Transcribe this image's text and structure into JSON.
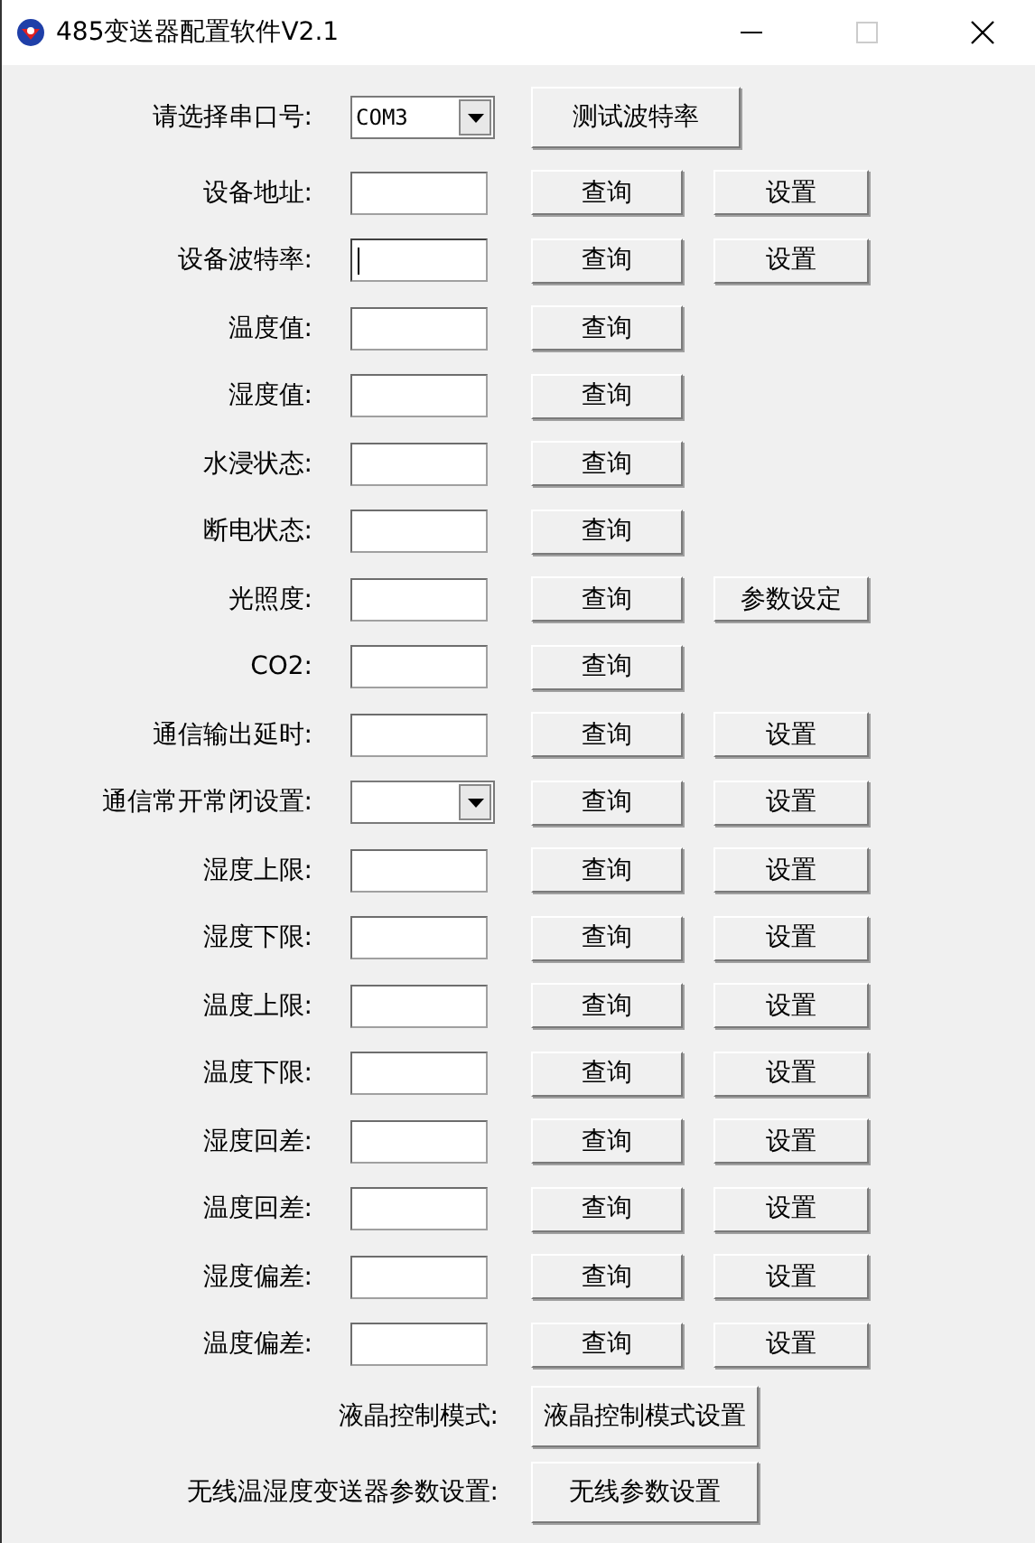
{
  "window": {
    "title": "485变送器配置软件V2.1"
  },
  "rows": [
    {
      "kind": "combo",
      "label": "请选择串口号:",
      "value": "COM3",
      "buttons": [
        "测试波特率"
      ]
    },
    {
      "kind": "field",
      "label": "设备地址:",
      "focused": false,
      "buttons": [
        "查询",
        "设置"
      ]
    },
    {
      "kind": "field",
      "label": "设备波特率:",
      "focused": true,
      "buttons": [
        "查询",
        "设置"
      ]
    },
    {
      "kind": "field",
      "label": "温度值:",
      "focused": false,
      "buttons": [
        "查询"
      ]
    },
    {
      "kind": "field",
      "label": "湿度值:",
      "focused": false,
      "buttons": [
        "查询"
      ]
    },
    {
      "kind": "field",
      "label": "水浸状态:",
      "focused": false,
      "buttons": [
        "查询"
      ]
    },
    {
      "kind": "field",
      "label": "断电状态:",
      "focused": false,
      "buttons": [
        "查询"
      ]
    },
    {
      "kind": "field",
      "label": "光照度:",
      "focused": false,
      "buttons": [
        "查询",
        "参数设定"
      ]
    },
    {
      "kind": "field",
      "label": "CO2:",
      "focused": false,
      "buttons": [
        "查询"
      ]
    },
    {
      "kind": "field",
      "label": "通信输出延时:",
      "focused": false,
      "buttons": [
        "查询",
        "设置"
      ]
    },
    {
      "kind": "dropdown",
      "label": "通信常开常闭设置:",
      "buttons": [
        "查询",
        "设置"
      ]
    },
    {
      "kind": "field",
      "label": "湿度上限:",
      "focused": false,
      "buttons": [
        "查询",
        "设置"
      ]
    },
    {
      "kind": "field",
      "label": "湿度下限:",
      "focused": false,
      "buttons": [
        "查询",
        "设置"
      ]
    },
    {
      "kind": "field",
      "label": "温度上限:",
      "focused": false,
      "buttons": [
        "查询",
        "设置"
      ]
    },
    {
      "kind": "field",
      "label": "温度下限:",
      "focused": false,
      "buttons": [
        "查询",
        "设置"
      ]
    },
    {
      "kind": "field",
      "label": "湿度回差:",
      "focused": false,
      "buttons": [
        "查询",
        "设置"
      ]
    },
    {
      "kind": "field",
      "label": "温度回差:",
      "focused": false,
      "buttons": [
        "查询",
        "设置"
      ]
    },
    {
      "kind": "field",
      "label": "湿度偏差:",
      "focused": false,
      "buttons": [
        "查询",
        "设置"
      ]
    },
    {
      "kind": "field",
      "label": "温度偏差:",
      "focused": false,
      "buttons": [
        "查询",
        "设置"
      ]
    },
    {
      "kind": "action",
      "label": "液晶控制模式:",
      "buttons": [
        "液晶控制模式设置"
      ]
    },
    {
      "kind": "action",
      "label": "无线温湿度变送器参数设置:",
      "buttons": [
        "无线参数设置"
      ]
    }
  ]
}
